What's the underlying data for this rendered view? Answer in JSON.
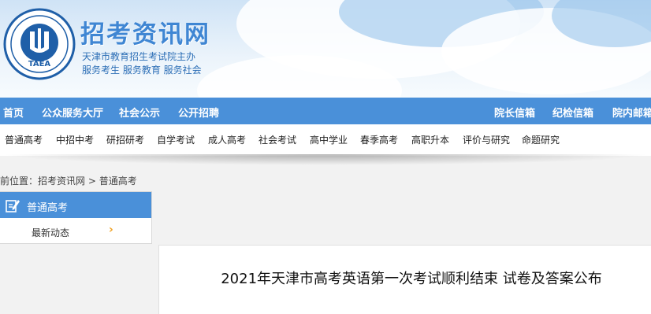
{
  "header": {
    "site_title": "招考资讯网",
    "logo_text": "TAEA",
    "subtitle_line1": "天津市教育招生考试院主办",
    "subtitle_line2": "服务考生 服务教育 服务社会"
  },
  "main_nav": {
    "left": [
      "首页",
      "公众服务大厅",
      "社会公示",
      "公开招聘"
    ],
    "right": [
      "院长信箱",
      "纪检信箱",
      "院内邮箱"
    ]
  },
  "sub_nav": [
    "普通高考",
    "中招中考",
    "研招研考",
    "自学考试",
    "成人高考",
    "社会考试",
    "高中学业",
    "春季高考",
    "高职升本",
    "评价与研究",
    "命题研究"
  ],
  "breadcrumb": {
    "prefix": "前位置：",
    "items": [
      "招考资讯网",
      "普通高考"
    ],
    "separator": ">"
  },
  "sidebar": {
    "heading": "普通高考",
    "heading_icon": "edit-icon",
    "items": [
      {
        "label": "最新动态",
        "arrow": "›"
      }
    ]
  },
  "article": {
    "title": "2021年天津市高考英语第一次考试顺利结束 试卷及答案公布"
  },
  "colors": {
    "nav_blue": "#4a90d9",
    "title_blue": "#3f86d3",
    "arrow_orange": "#f0a020"
  }
}
